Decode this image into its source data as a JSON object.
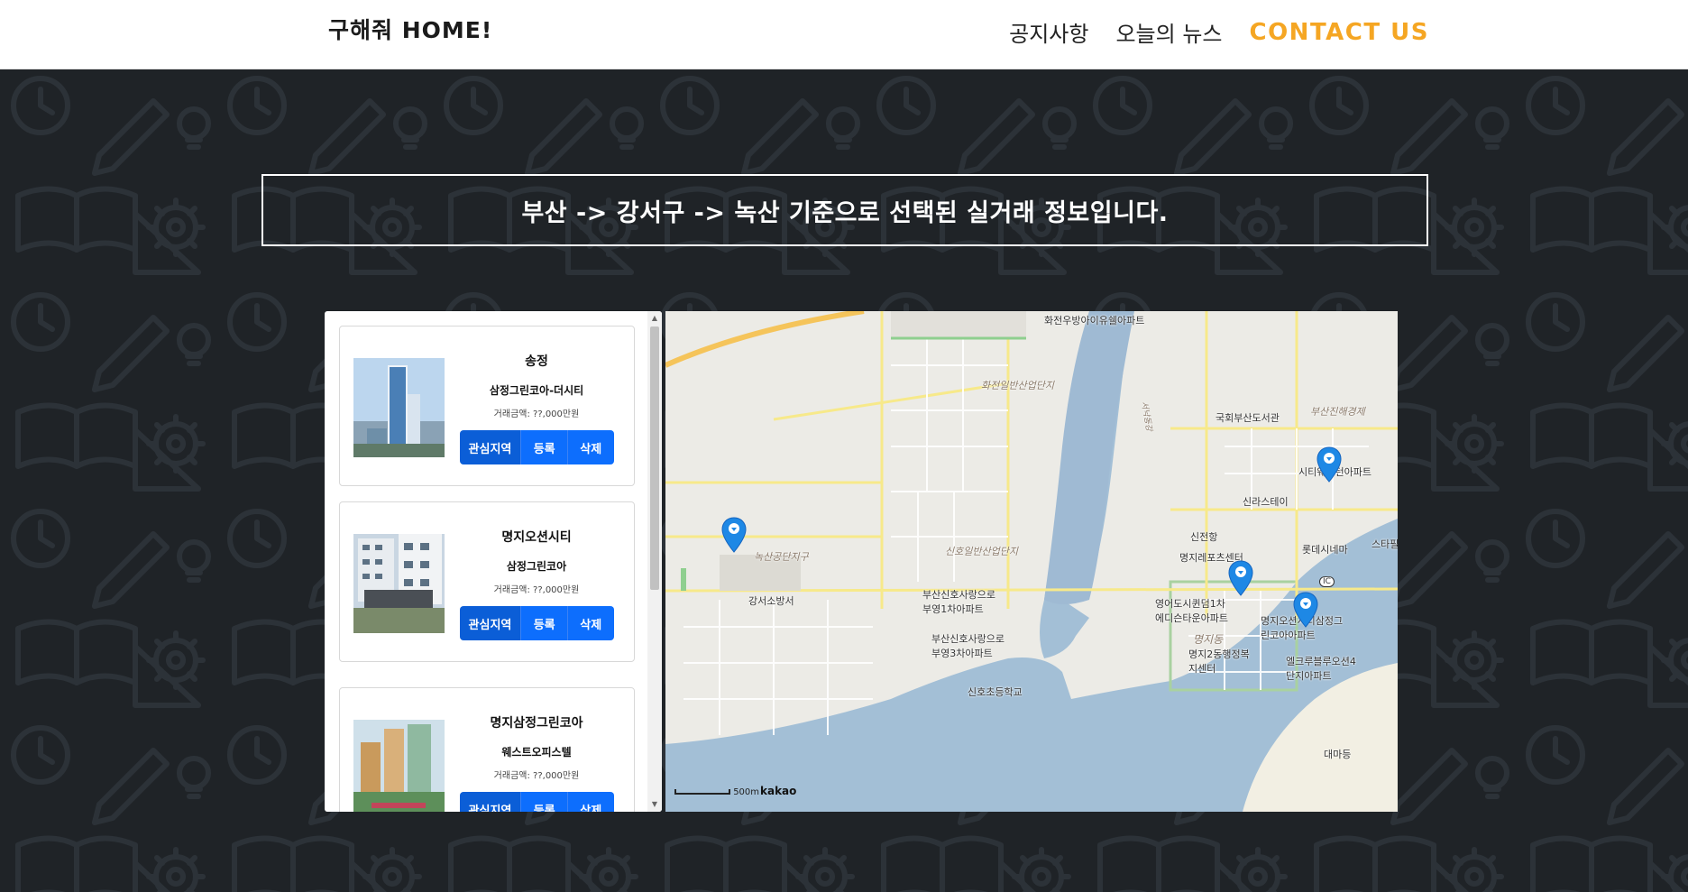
{
  "navbar": {
    "brand": "구해줘 HOME!",
    "links": [
      "공지사항",
      "오늘의 뉴스",
      "CONTACT US"
    ],
    "accent_color": "#f5a623"
  },
  "banner": {
    "text": "부산 -> 강서구 -> 녹산 기준으로 선택된 실거래 정보입니다."
  },
  "listings": [
    {
      "dong": "송정",
      "apt": "삼정그린코아-더시티",
      "price": "거래금액: ??,000만원",
      "buttons": [
        "관심지역",
        "등록",
        "삭제"
      ]
    },
    {
      "dong": "명지오션시티",
      "apt": "삼정그린코아",
      "price": "거래금액: ??,000만원",
      "buttons": [
        "관심지역",
        "등록",
        "삭제"
      ]
    },
    {
      "dong": "명지삼정그린코아",
      "apt": "웨스트오피스텔",
      "price": "거래금액: ??,000만원",
      "buttons": [
        "관심지역",
        "등록",
        "삭제"
      ]
    }
  ],
  "map": {
    "labels": [
      "화전우방아이유쉘아파트",
      "화전일반산업단지",
      "국회부산도서관",
      "부산진해경제",
      "서낙동강",
      "시티웨스턴아파트",
      "신라스테이",
      "신전항",
      "명지레포츠센터",
      "롯데시네마",
      "스타필",
      "녹산공단지구",
      "신호일반산업단지",
      "강서소방서",
      "부산신호사랑으로부영1차아파트",
      "부산신호사랑으로부영3차아파트",
      "신호초등학교",
      "영어도시퀸덤1차에디슨타운아파트",
      "명지오션시티삼정그린코아아파트",
      "명지2동행정복지센터",
      "엘크루블루오션4단지아파트",
      "대마등",
      "IC",
      "명지동"
    ],
    "scale": "500m",
    "provider": "kakao",
    "marker_color": "#1e88e5"
  }
}
